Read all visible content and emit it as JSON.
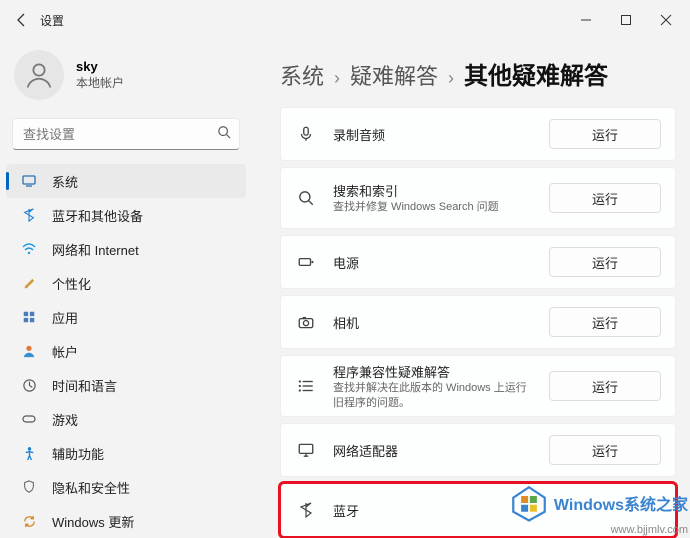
{
  "window": {
    "title": "设置"
  },
  "user": {
    "name": "sky",
    "subtitle": "本地帐户"
  },
  "search": {
    "placeholder": "查找设置"
  },
  "nav": {
    "items": [
      {
        "label": "系统"
      },
      {
        "label": "蓝牙和其他设备"
      },
      {
        "label": "网络和 Internet"
      },
      {
        "label": "个性化"
      },
      {
        "label": "应用"
      },
      {
        "label": "帐户"
      },
      {
        "label": "时间和语言"
      },
      {
        "label": "游戏"
      },
      {
        "label": "辅助功能"
      },
      {
        "label": "隐私和安全性"
      },
      {
        "label": "Windows 更新"
      }
    ]
  },
  "breadcrumb": {
    "root": "系统",
    "mid": "疑难解答",
    "current": "其他疑难解答"
  },
  "run_label": "运行",
  "troubleshooters": [
    {
      "title": "录制音频",
      "sub": ""
    },
    {
      "title": "搜索和索引",
      "sub": "查找并修复 Windows Search 问题"
    },
    {
      "title": "电源",
      "sub": ""
    },
    {
      "title": "相机",
      "sub": ""
    },
    {
      "title": "程序兼容性疑难解答",
      "sub": "查找并解决在此版本的 Windows 上运行旧程序的问题。"
    },
    {
      "title": "网络适配器",
      "sub": ""
    },
    {
      "title": "蓝牙",
      "sub": ""
    }
  ],
  "watermark": {
    "line1": "Windows系统之家",
    "line2": "www.bjjmlv.com"
  }
}
